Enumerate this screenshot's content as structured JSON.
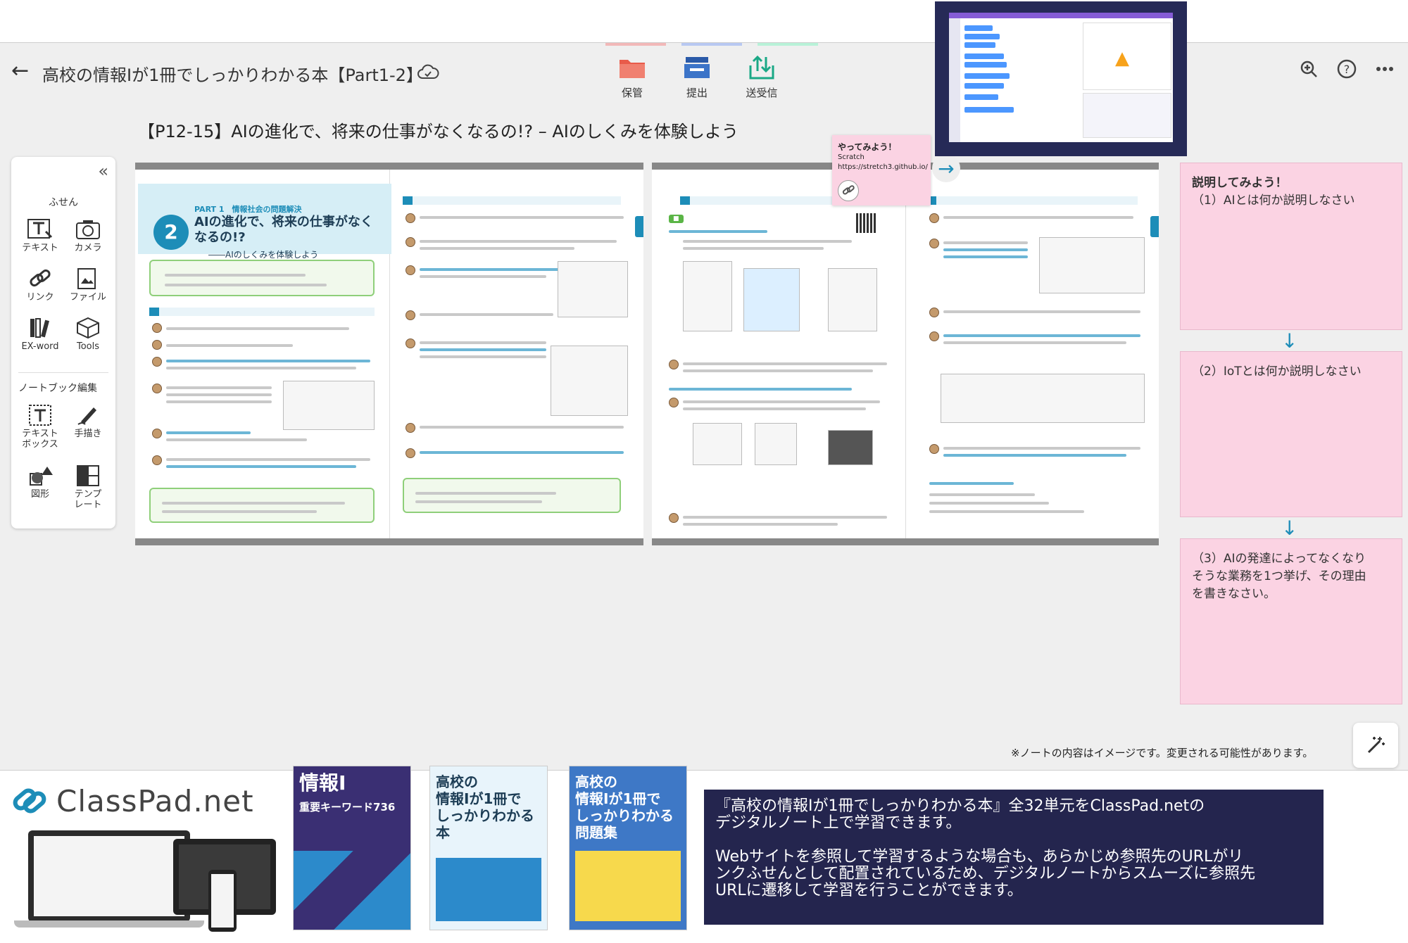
{
  "app": {
    "doc_title": "高校の情報Ⅰが1冊でしっかりわかる本【Part1-2】",
    "toolbar": {
      "save_label": "保管",
      "submit_label": "提出",
      "transfer_label": "送受信"
    },
    "tab_colors": [
      "#f2b8b8",
      "#b8c8f2",
      "#b8f2d8"
    ]
  },
  "palette": {
    "fusen_heading": "ふせん",
    "tools": [
      {
        "label": "テキスト",
        "icon": "text-tool-icon"
      },
      {
        "label": "カメラ",
        "icon": "camera-icon"
      },
      {
        "label": "リンク",
        "icon": "link-icon"
      },
      {
        "label": "ファイル",
        "icon": "file-icon"
      },
      {
        "label": "EX-word",
        "icon": "dictionary-icon"
      },
      {
        "label": "Tools",
        "icon": "box-icon"
      }
    ],
    "notebook_heading": "ノートブック編集",
    "notebook_tools": [
      {
        "label": "テキスト\nボックス",
        "icon": "textbox-icon"
      },
      {
        "label": "手描き",
        "icon": "pen-icon"
      },
      {
        "label": "図形",
        "icon": "shape-icon"
      },
      {
        "label": "テンプ\nレート",
        "icon": "template-icon"
      }
    ]
  },
  "page_heading": "【P12-15】AIの進化で、将来の仕事がなくなるの!? – AIのしくみを体験しよう",
  "fusen_note": {
    "title": "やってみよう！",
    "name": "Scratch",
    "url": "https://stretch3.github.io/"
  },
  "notes": [
    {
      "title": "説明してみよう！",
      "text": "（1）AIとは何か説明しなさい"
    },
    {
      "title": "",
      "text": "（2）IoTとは何か説明しなさい"
    },
    {
      "title": "",
      "text": "（3）AIの発達によってなくなり\nそうな業務を1つ挙げ、その理由\nを書きなさい。"
    }
  ],
  "disclaimer": "※ノートの内容はイメージです。変更される可能性があります。",
  "book_page": {
    "part": "PART 1　情報社会の問題解決",
    "number": "2",
    "title": "AIの進化で、将来の仕事がなくなるの!?",
    "subtitle": "――AIのしくみを体験しよう"
  },
  "promo": {
    "brand": "ClassPad.net",
    "books": [
      {
        "title": "情報Ⅰ",
        "subtitle": "重要キーワード736",
        "bg": "#3a2f73"
      },
      {
        "title": "高校の\n情報Ⅰが1冊で\nしっかりわかる本",
        "subtitle": "",
        "bg": "#e8f4fb"
      },
      {
        "title": "高校の\n情報Ⅰが1冊で\nしっかりわかる\n問題集",
        "subtitle": "",
        "bg": "#3e78c6"
      }
    ],
    "info_paragraph_1": "『高校の情報Ⅰが1冊でしっかりわかる本』全32単元をClassPad.netの\nデジタルノート上で学習できます。",
    "info_paragraph_2": "Webサイトを参照して学習するような場合も、あらかじめ参照先のURLがリ\nンクふせんとして配置されているため、デジタルノートからスムーズに参照先\nURLに遷移して学習を行うことができます。"
  },
  "colors": {
    "accent": "#1d8db8",
    "note_pink": "#fbd3e3",
    "info_box": "#24254e"
  }
}
